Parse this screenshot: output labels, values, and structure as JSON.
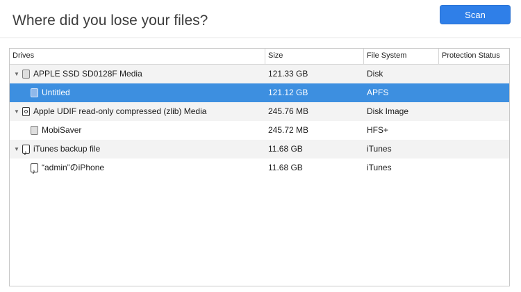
{
  "header": {
    "title": "Where did you lose your files?",
    "scan_label": "Scan",
    "accent_color": "#2f7fe8"
  },
  "table": {
    "columns": [
      "Drives",
      "Size",
      "File System",
      "Protection Status"
    ],
    "rows": [
      {
        "name": "APPLE SSD SD0128F Media",
        "size": "121.33 GB",
        "file_system": "Disk",
        "icon": "drive-icon",
        "expanded": true
      },
      {
        "name": "Untitled",
        "size": "121.12 GB",
        "file_system": "APFS",
        "icon": "volume-icon",
        "selected": true
      },
      {
        "name": "Apple UDIF read-only compressed (zlib) Media",
        "size": "245.76 MB",
        "file_system": "Disk Image",
        "icon": "disk-image-icon",
        "expanded": true
      },
      {
        "name": "MobiSaver",
        "size": "245.72 MB",
        "file_system": "HFS+",
        "icon": "volume-icon"
      },
      {
        "name": "iTunes backup file",
        "size": "11.68 GB",
        "file_system": "iTunes",
        "icon": "itunes-icon",
        "expanded": true
      },
      {
        "name": "“admin”のiPhone",
        "size": "11.68 GB",
        "file_system": "iTunes",
        "icon": "itunes-icon"
      }
    ],
    "selected_color": "#3d8fe0"
  }
}
